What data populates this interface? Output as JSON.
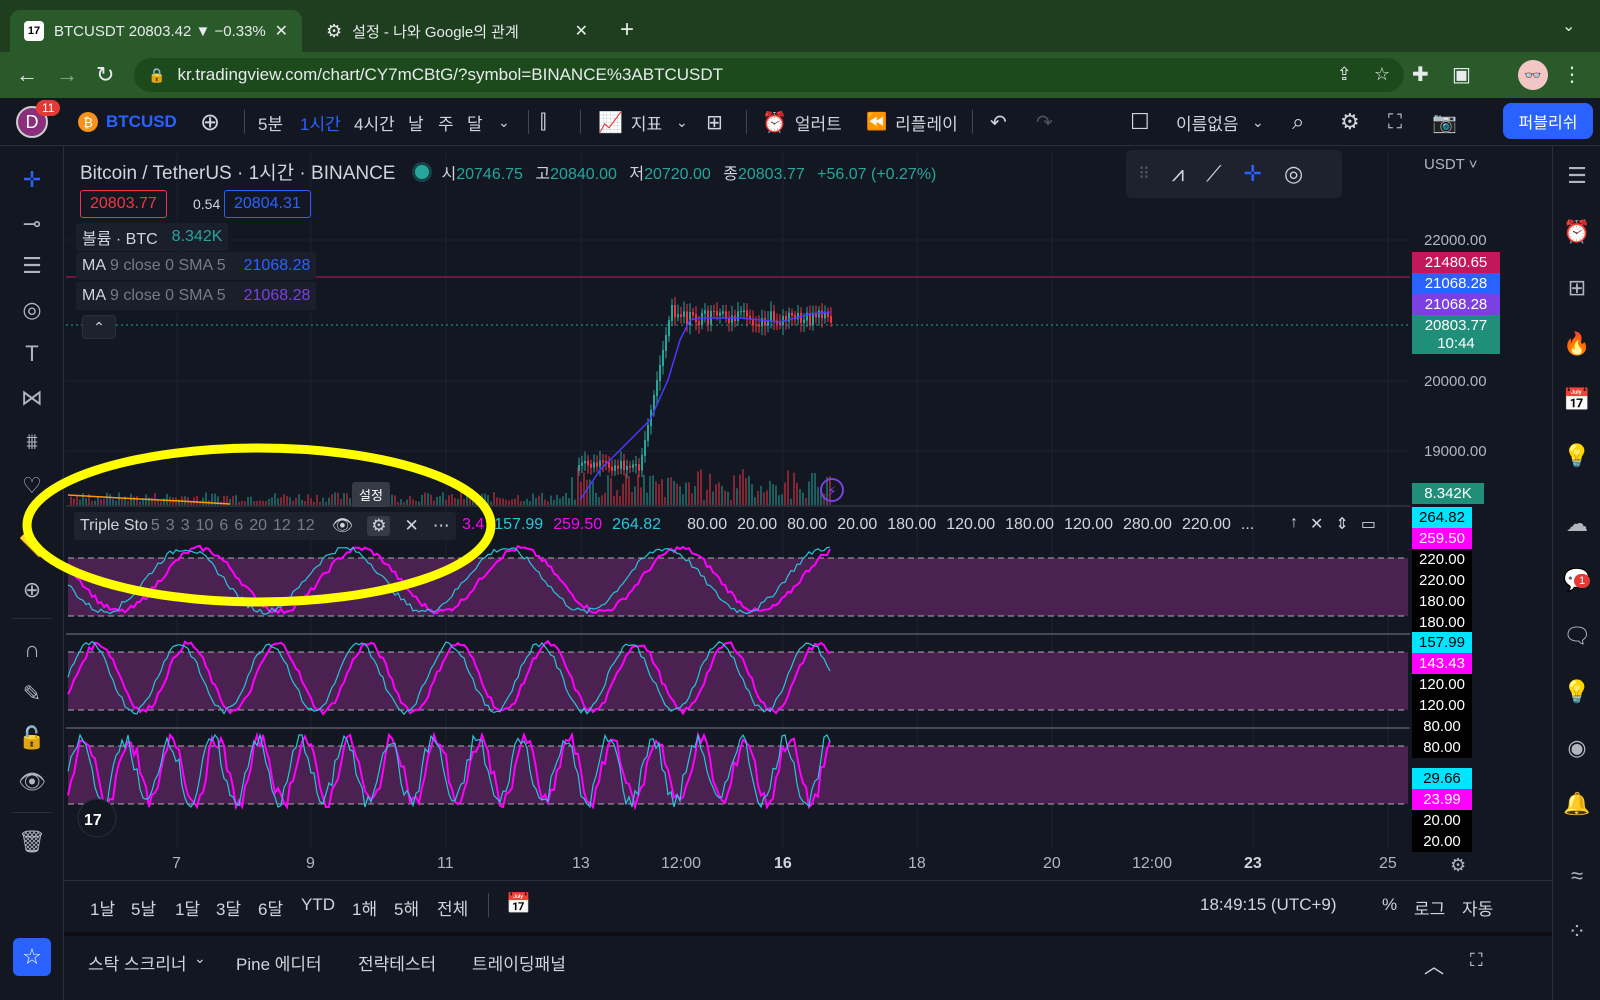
{
  "browser": {
    "active_tab": "BTCUSDT 20803.42 ▼ −0.33%",
    "inactive_tab": "설정 - 나와 Google의 관계",
    "url": "kr.tradingview.com/chart/CY7mCBtG/?symbol=BINANCE%3ABTCUSDT"
  },
  "toolbar": {
    "avatar_letter": "D",
    "notif_count": "11",
    "symbol": "BTCUSD",
    "intervals": [
      "5분",
      "1시간",
      "4시간",
      "날",
      "주",
      "달"
    ],
    "indicators_label": "지표",
    "alert_label": "얼러트",
    "replay_label": "리플레이",
    "layout_name": "이름없음",
    "publish_label": "퍼블리쉬"
  },
  "legend": {
    "title": "Bitcoin / TetherUS · 1시간 · BINANCE",
    "open_label": "시",
    "open": "20746.75",
    "high_label": "고",
    "high": "20840.00",
    "low_label": "저",
    "low": "20720.00",
    "close_label": "종",
    "close": "20803.77",
    "change": "+56.07 (+0.27%)",
    "sell_price": "20803.77",
    "spread": "0.54",
    "buy_price": "20804.31",
    "volume_label": "볼륨 · BTC",
    "volume_value": "8.342K",
    "ma1_name": "MA",
    "ma1_params": "9 close 0 SMA 5",
    "ma1_value": "21068.28",
    "ma2_name": "MA",
    "ma2_params": "9 close 0 SMA 5",
    "ma2_value": "21068.28"
  },
  "price_axis": {
    "currency": "USDT",
    "labels": [
      "22000.00",
      "20000.00",
      "19000.00"
    ],
    "tag_high": "21480.65",
    "tag_ma1": "21068.28",
    "tag_ma2": "21068.28",
    "tag_last": "20803.77",
    "tag_countdown": "10:44",
    "tag_volume": "8.342K"
  },
  "indicator": {
    "name": "Triple Sto",
    "params": [
      "5",
      "3",
      "3",
      "10",
      "6",
      "6",
      "20",
      "12",
      "12"
    ],
    "tooltip": "설정",
    "values_partial": "3.4",
    "values": [
      "157.99",
      "259.50",
      "264.82"
    ],
    "levels": [
      "80.00",
      "20.00",
      "80.00",
      "20.00",
      "180.00",
      "120.00",
      "180.00",
      "120.00",
      "280.00",
      "220.00",
      "..."
    ],
    "pane1_tags": [
      "264.82",
      "259.50",
      "220.00",
      "220.00",
      "180.00",
      "180.00"
    ],
    "pane2_tags": [
      "157.99",
      "143.43",
      "120.00",
      "120.00",
      "80.00",
      "80.00"
    ],
    "pane3_tags": [
      "29.66",
      "23.99",
      "20.00",
      "20.00"
    ]
  },
  "time_axis": [
    "7",
    "9",
    "11",
    "13",
    "12:00",
    "16",
    "18",
    "20",
    "12:00",
    "23",
    "25"
  ],
  "ranges": [
    "1날",
    "5날",
    "1달",
    "3달",
    "6달",
    "YTD",
    "1해",
    "5해",
    "전체"
  ],
  "clock": "18:49:15 (UTC+9)",
  "scale_opts": [
    "%",
    "로그",
    "자동"
  ],
  "panels": [
    "스탁 스크리너",
    "Pine 에디터",
    "전략테스터",
    "트레이딩패널"
  ],
  "colors": {
    "up": "#26a69a",
    "down": "#f23645",
    "accent": "#2962ff",
    "stoch_k": "#ff00ff",
    "stoch_d": "#26c6da",
    "pane_fill": "#4a2150",
    "highlight": "#ffff00"
  }
}
